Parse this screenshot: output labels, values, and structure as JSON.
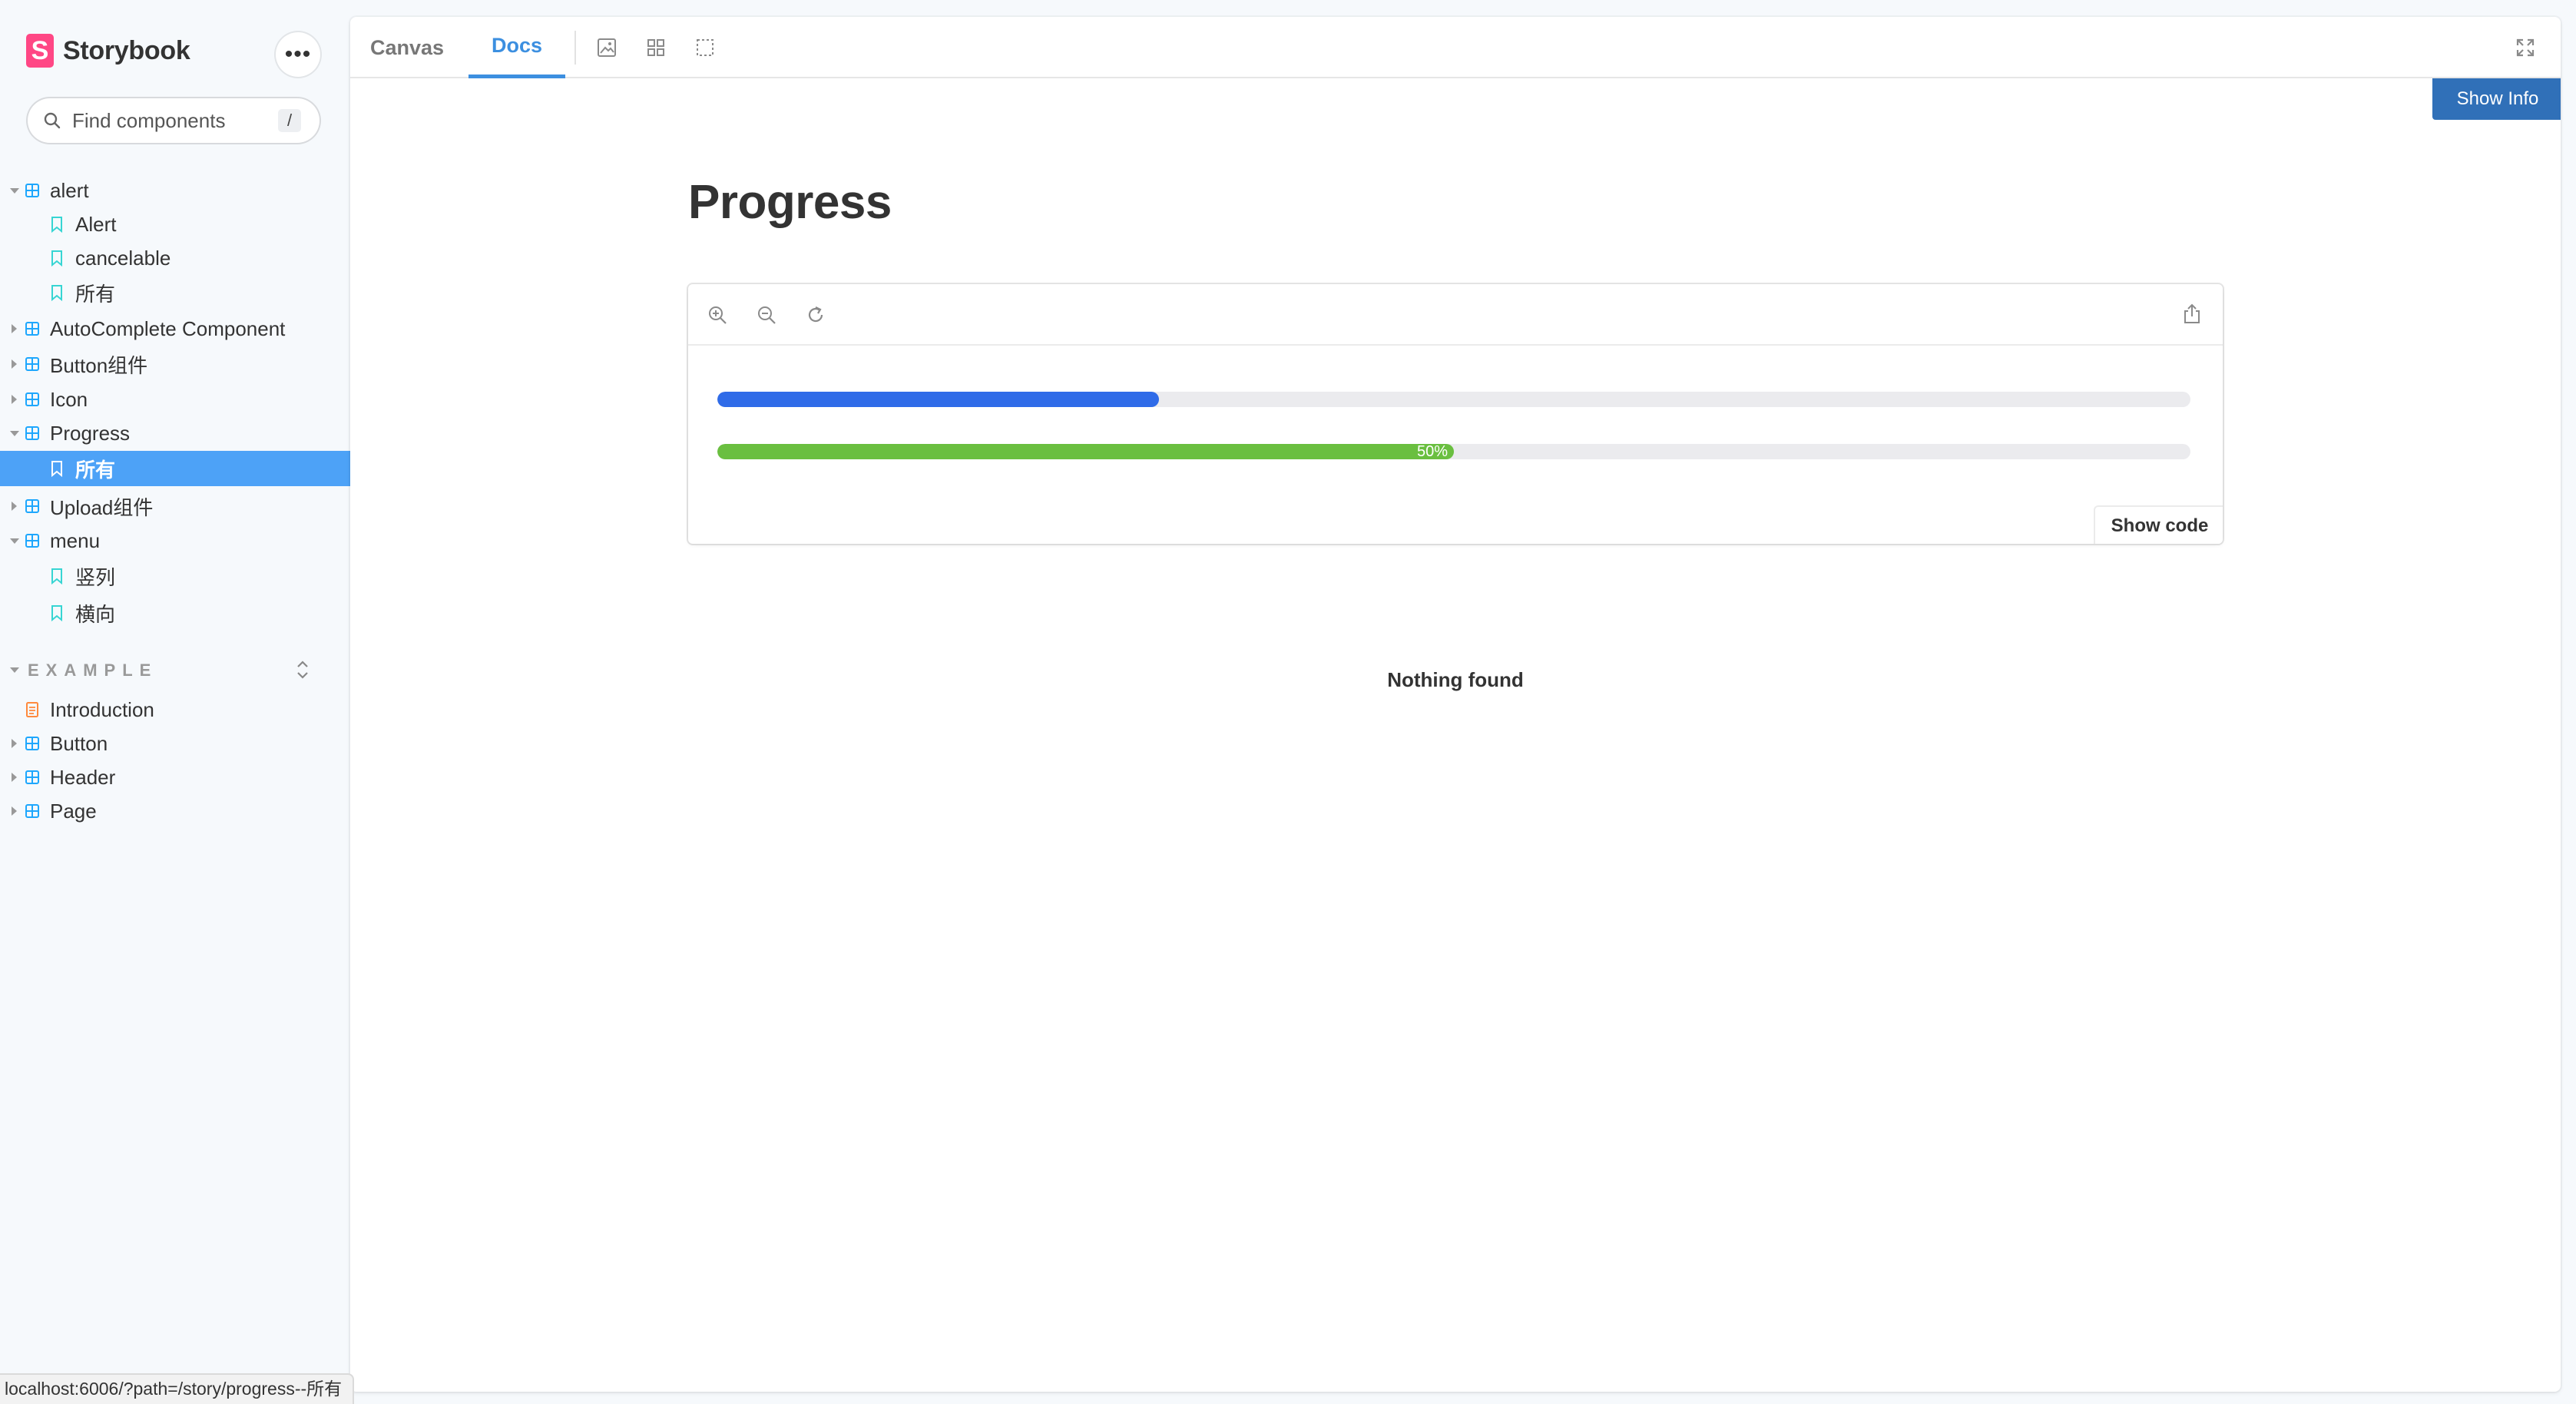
{
  "sidebar": {
    "brand": {
      "logo_letter": "S",
      "name": "Storybook"
    },
    "more_button": "•••",
    "search": {
      "placeholder": "Find components",
      "shortcut": "/"
    },
    "tree": [
      {
        "label": "alert",
        "type": "component",
        "expanded": true
      },
      {
        "label": "Alert",
        "type": "story"
      },
      {
        "label": "cancelable",
        "type": "story"
      },
      {
        "label": "所有",
        "type": "story"
      },
      {
        "label": "AutoComplete Component",
        "type": "component",
        "expanded": false
      },
      {
        "label": "Button组件",
        "type": "component",
        "expanded": false
      },
      {
        "label": "Icon",
        "type": "component",
        "expanded": false
      },
      {
        "label": "Progress",
        "type": "component",
        "expanded": true
      },
      {
        "label": "所有",
        "type": "story",
        "selected": true
      },
      {
        "label": "Upload组件",
        "type": "component",
        "expanded": false
      },
      {
        "label": "menu",
        "type": "component",
        "expanded": true
      },
      {
        "label": "竖列",
        "type": "story"
      },
      {
        "label": "横向",
        "type": "story"
      }
    ],
    "section": {
      "label": "EXAMPLE",
      "items": [
        {
          "label": "Introduction",
          "type": "doc"
        },
        {
          "label": "Button",
          "type": "component",
          "expanded": false
        },
        {
          "label": "Header",
          "type": "component",
          "expanded": false
        },
        {
          "label": "Page",
          "type": "component",
          "expanded": false
        }
      ]
    }
  },
  "toolbar": {
    "tabs": [
      {
        "label": "Canvas",
        "active": false
      },
      {
        "label": "Docs",
        "active": true
      }
    ],
    "tools": [
      "image-icon",
      "grid-icon",
      "outline-icon"
    ],
    "fullscreen": "fullscreen-icon"
  },
  "main": {
    "show_info": "Show Info",
    "title": "Progress",
    "preview": {
      "zoom_tools": [
        "zoom-in-icon",
        "zoom-out-icon",
        "zoom-reset-icon"
      ],
      "share": "share-icon",
      "progress_bars": [
        {
          "percent": 30,
          "color": "#2F6BE8",
          "text": ""
        },
        {
          "percent": 50,
          "color": "#6ABF40",
          "text": "50%"
        }
      ],
      "show_code": "Show code"
    },
    "nothing_found": "Nothing found"
  },
  "status_bar": {
    "url": "localhost:6006/?path=/story/progress--所有"
  },
  "colors": {
    "accent": "#3C8FE0",
    "selected_row": "#4DA2F7",
    "brand": "#FF4785",
    "show_info_bg": "#3070B8"
  }
}
